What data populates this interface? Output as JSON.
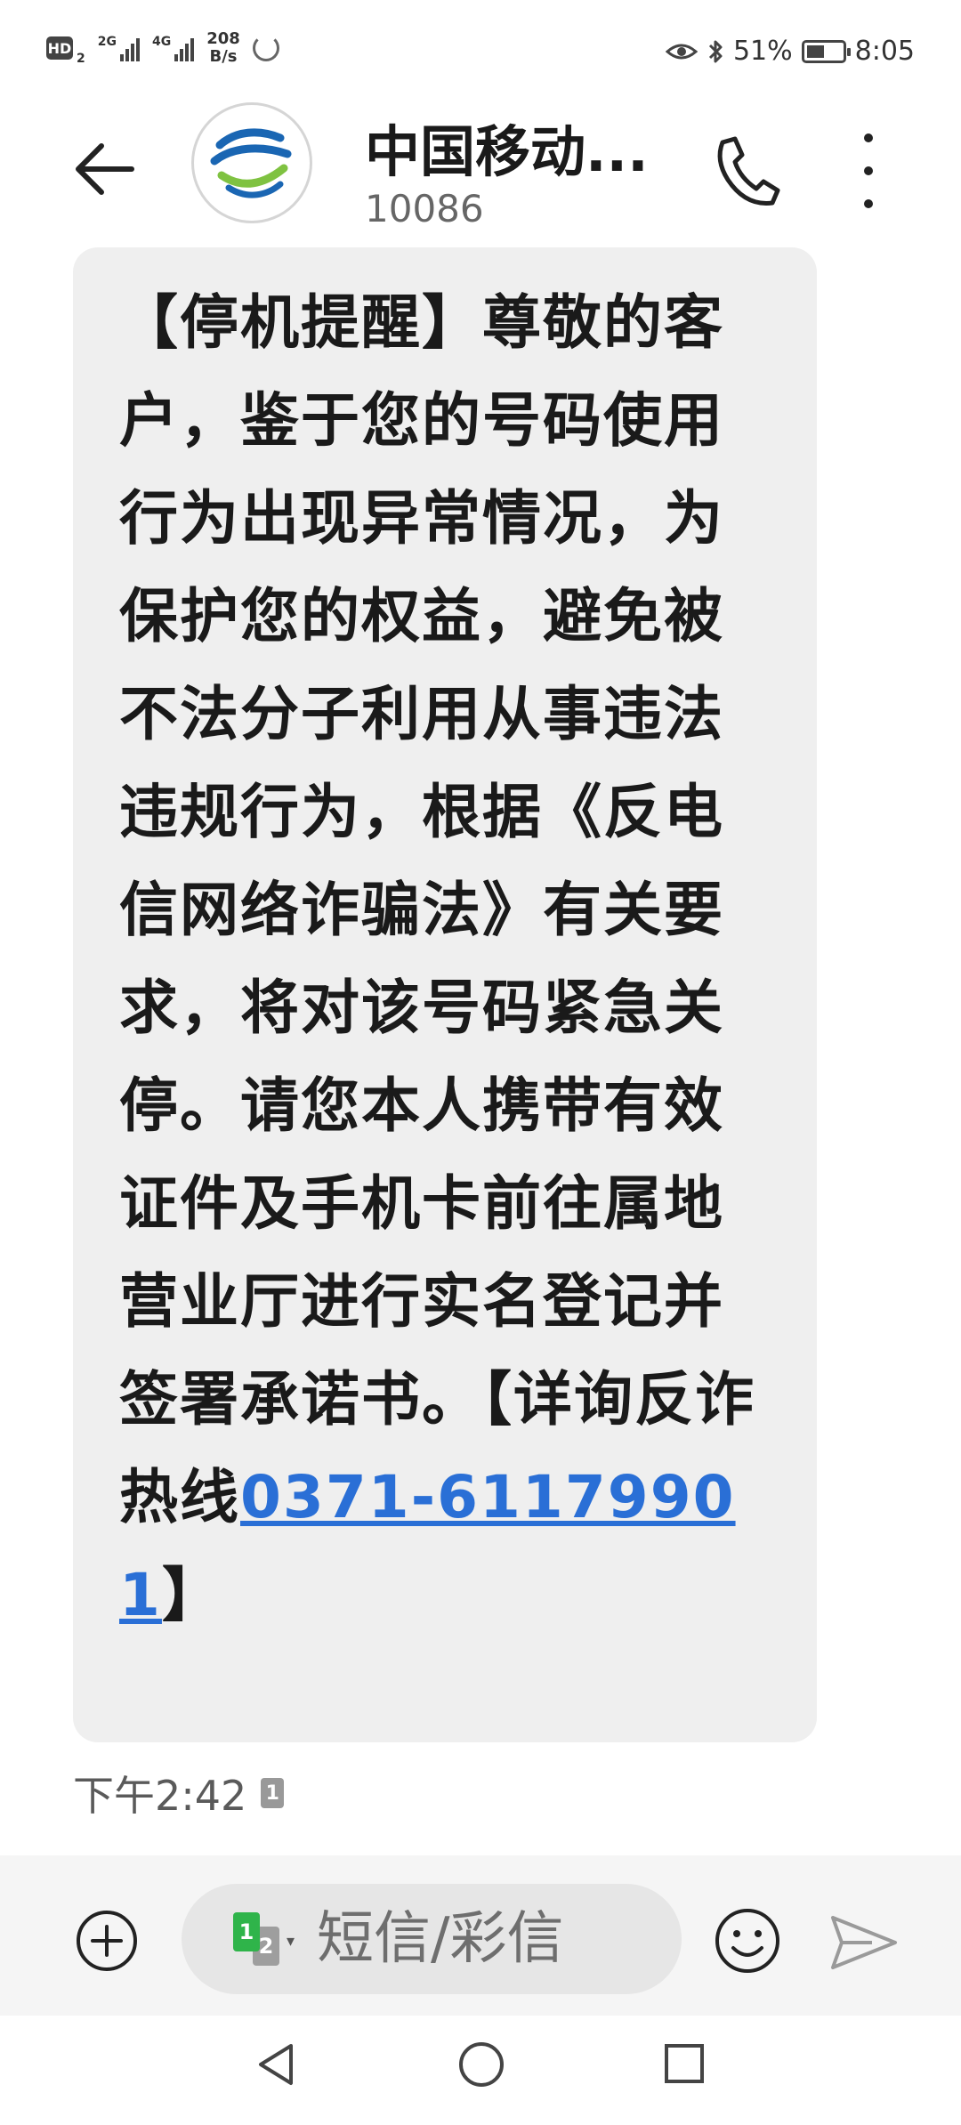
{
  "status_bar": {
    "hd_label": "HD",
    "hd_sub": "2",
    "sim1_network": "2G",
    "sim2_network": "4G",
    "net_speed_value": "208",
    "net_speed_unit": "B/s",
    "battery_percent": "51%",
    "battery_level": 0.51,
    "time": "8:05"
  },
  "header": {
    "contact_name": "中国移动...",
    "contact_number": "10086",
    "back_icon": "back-arrow-icon",
    "call_icon": "phone-icon",
    "more_icon": "more-vertical-icon"
  },
  "message": {
    "text_before_link": "【停机提醒】尊敬的客户，鉴于您的号码使用行为出现异常情况，为保护您的权益，避免被不法分子利用从事违法违规行为，根据《反电信网络诈骗法》有关要求，将对该号码紧急关停。请您本人携带有效证件及手机卡前往属地营业厅进行实名登记并签署承诺书。【详询反诈热线",
    "link_text": "0371-61179901",
    "text_after_link": "】",
    "time": "下午2:42",
    "sim_tag": "1"
  },
  "input_bar": {
    "placeholder": "短信/彩信",
    "sim1_label": "1",
    "sim2_label": "2",
    "add_icon": "add-circle-icon",
    "emoji_icon": "emoji-icon",
    "send_icon": "send-icon"
  },
  "colors": {
    "bubble_bg": "#efefef",
    "link": "#2a6fd6",
    "sim1_green": "#2fb44a",
    "input_bar_bg": "#f5f5f5"
  }
}
